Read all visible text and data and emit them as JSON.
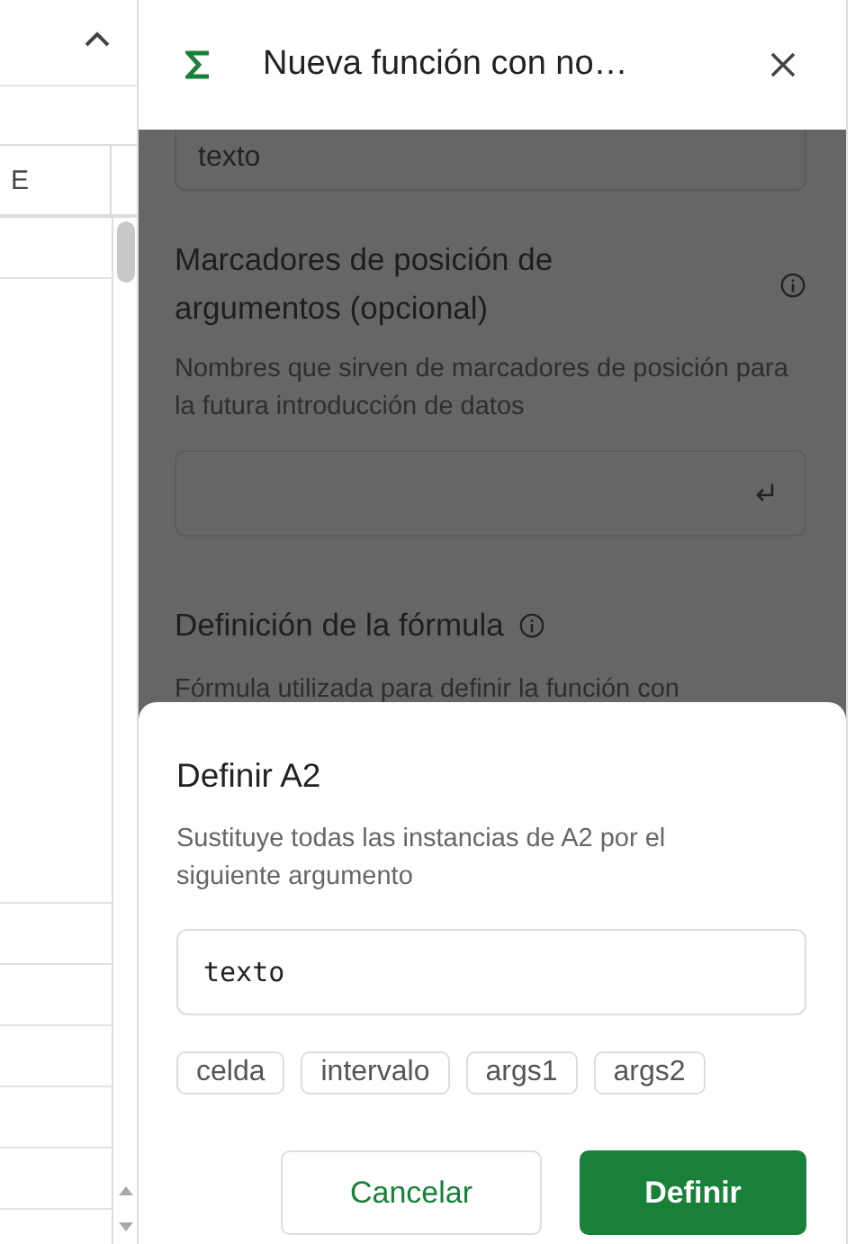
{
  "spreadsheet": {
    "column_header": "E"
  },
  "panel": {
    "title": "Nueva función con no…",
    "description_field": {
      "value": "texto"
    },
    "placeholders_section": {
      "heading": "Marcadores de posición de argumentos (opcional)",
      "helper": "Nombres que sirven de marcadores de posición para la futura introducción de datos"
    },
    "formula_section": {
      "heading": "Definición de la fórmula",
      "helper": "Fórmula utilizada para definir la función con"
    }
  },
  "dialog": {
    "title": "Definir A2",
    "description": "Sustituye todas las instancias de A2 por el siguiente argumento",
    "value": "texto",
    "chips": [
      "celda",
      "intervalo",
      "args1",
      "args2"
    ],
    "buttons": [
      {
        "label": "Cancelar",
        "kind": "secondary"
      },
      {
        "label": "Definir",
        "kind": "primary"
      }
    ]
  }
}
